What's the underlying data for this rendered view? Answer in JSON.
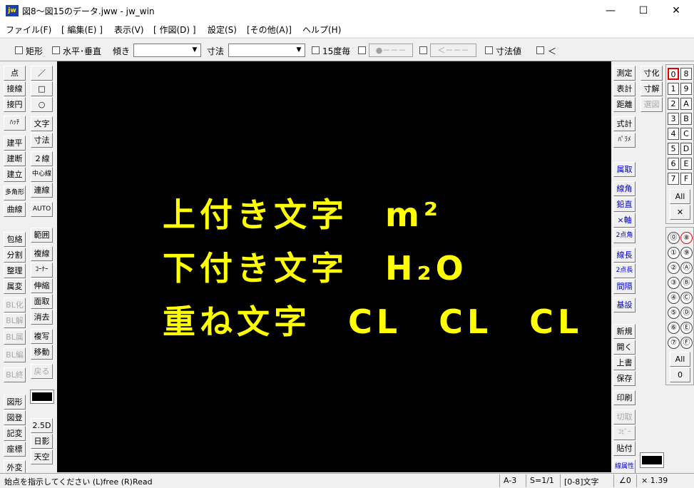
{
  "window": {
    "title": "図8～図15のデータ.jww - jw_win",
    "app_icon_text": "jw",
    "minimize": "—",
    "maximize": "☐",
    "close": "✕"
  },
  "menu": [
    "ファイル(F)",
    "[ 編集(E) ]",
    "表示(V)",
    "[ 作図(D) ]",
    "設定(S)",
    "[その他(A)]",
    "ヘルプ(H)"
  ],
  "options": {
    "rect": "矩形",
    "horiz_vert": "水平･垂直",
    "tilt_label": "傾き",
    "tilt_value": "",
    "size_label": "寸法",
    "size_value": "",
    "deg15": "15度毎",
    "point_btn": "●－－－",
    "arrow_btn": "＜－－－",
    "dim_value": "寸法値",
    "lt": "＜"
  },
  "left_tools_col1": [
    "点",
    "接線",
    "接円",
    "ﾊｯﾁ",
    "建平",
    "建断",
    "建立",
    "多角形",
    "曲線",
    "包絡",
    "分割",
    "整理",
    "属変",
    "BL化",
    "BL解",
    "BL属",
    "BL編",
    "BL終",
    "図形",
    "図登",
    "記変",
    "座標",
    "外変"
  ],
  "left_tools_col2": [
    "／",
    "□",
    "○",
    "文字",
    "寸法",
    "２線",
    "中心線",
    "連線",
    "AUTO",
    "範囲",
    "複線",
    "ｺｰﾅｰ",
    "伸縮",
    "面取",
    "消去",
    "複写",
    "移動",
    "戻る",
    "2.5D",
    "日影",
    "天空"
  ],
  "right_tools_col1": [
    "測定",
    "表計",
    "距離",
    "式計",
    "ﾊﾟﾗﾒ",
    "属取",
    "線角",
    "鉛直",
    "×軸",
    "2点角",
    "線長",
    "2点長",
    "間隔",
    "基設",
    "新規",
    "開く",
    "上書",
    "保存",
    "印刷",
    "切取",
    "ｺﾋﾟｰ",
    "貼付",
    "線属性"
  ],
  "right_tools_col2": [
    "寸化",
    "寸解",
    "選図"
  ],
  "layers": [
    "0",
    "1",
    "2",
    "3",
    "4",
    "5",
    "6",
    "7",
    "8",
    "9",
    "A",
    "B",
    "C",
    "D",
    "E",
    "F"
  ],
  "layer_all": "All",
  "layer_x": "✕",
  "groups": [
    "⓪",
    "①",
    "②",
    "③",
    "④",
    "⑤",
    "⑥",
    "⑦",
    "⑧",
    "⑨",
    "Ⓐ",
    "Ⓑ",
    "Ⓒ",
    "Ⓓ",
    "Ⓔ",
    "Ⓕ"
  ],
  "group_all": "All",
  "group_zero": "0",
  "canvas": {
    "line1": "上付き文字　m²",
    "line2": "下付き文字　H₂O",
    "line3": "重ね文字　CL　CL　CL"
  },
  "status": {
    "prompt": "始点を指示してください (L)free (R)Read",
    "paper": "A-3",
    "scale": "S=1/1",
    "mode": "[0-8]文字",
    "angle": "∠0",
    "zoom": "× 1.39"
  },
  "colors": {
    "canvas_bg": "#000000",
    "cad_text": "#ffff00",
    "active_layer": "#e00000",
    "blue_tool": "#0000c8"
  }
}
